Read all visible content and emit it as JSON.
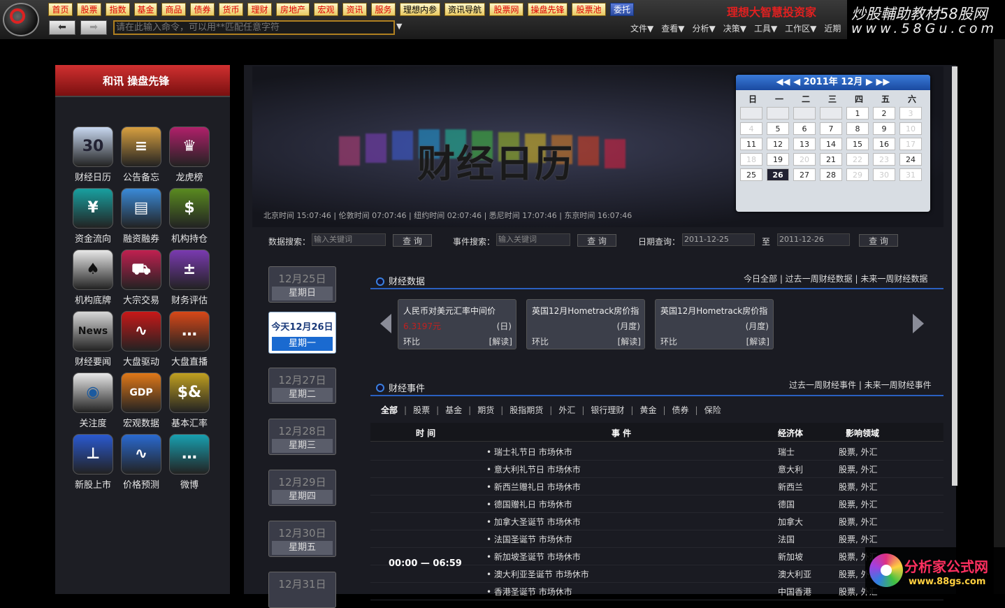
{
  "toolbar": {
    "nav": [
      "首页",
      "股票",
      "指数",
      "基金",
      "商品",
      "债券",
      "货币",
      "理财",
      "房地产",
      "宏观",
      "资讯",
      "服务",
      "理想内参",
      "资讯导航",
      "股票网",
      "操盘先锋",
      "股票池",
      "委托"
    ],
    "brand": "理想大智慧投资家",
    "command_placeholder": "请在此输入命令，可以用**匹配任意字符",
    "menu": [
      "文件▼",
      "查看▼",
      "分析▼",
      "决策▼",
      "工具▼",
      "工作区▼",
      "近期"
    ]
  },
  "watermark_top": {
    "line1": "炒股輔助教材58股网",
    "line2": "www.58Gu.com"
  },
  "watermark_bottom": {
    "line1": "分析家公式网",
    "line2": "www.88gs.com"
  },
  "left_panel": {
    "title": "和讯 操盘先锋",
    "tiles": [
      {
        "label": "财经日历",
        "glyph": "30",
        "color": "#c8d8f0",
        "text_color": "#223"
      },
      {
        "label": "公告备忘",
        "glyph": "≡",
        "color": "#d8a040",
        "text_color": "#fff"
      },
      {
        "label": "龙虎榜",
        "glyph": "♛",
        "color": "#b0206a",
        "text_color": "#fff"
      },
      {
        "label": "资金流向",
        "glyph": "¥",
        "color": "#18a0a0",
        "text_color": "#fff"
      },
      {
        "label": "融资融券",
        "glyph": "▤",
        "color": "#3a8ad8",
        "text_color": "#fff"
      },
      {
        "label": "机构持仓",
        "glyph": "$",
        "color": "#5a8a20",
        "text_color": "#fff"
      },
      {
        "label": "机构底牌",
        "glyph": "♠",
        "color": "#e8e8e8",
        "text_color": "#111"
      },
      {
        "label": "大宗交易",
        "glyph": "⛟",
        "color": "#c02050",
        "text_color": "#fff"
      },
      {
        "label": "财务评估",
        "glyph": "±",
        "color": "#7a3ab0",
        "text_color": "#fff"
      },
      {
        "label": "财经要闻",
        "glyph": "News",
        "color": "#d8d8d8",
        "text_color": "#111"
      },
      {
        "label": "大盘驱动",
        "glyph": "∿",
        "color": "#c81818",
        "text_color": "#fff"
      },
      {
        "label": "大盘直播",
        "glyph": "…",
        "color": "#d84818",
        "text_color": "#fff"
      },
      {
        "label": "关注度",
        "glyph": "◉",
        "color": "#e8e8e8",
        "text_color": "#1a5aa0"
      },
      {
        "label": "宏观数据",
        "glyph": "GDP",
        "color": "#e07818",
        "text_color": "#fff"
      },
      {
        "label": "基本汇率",
        "glyph": "$&",
        "color": "#c0a020",
        "text_color": "#fff"
      },
      {
        "label": "新股上市",
        "glyph": "⊥",
        "color": "#2a5ad0",
        "text_color": "#fff"
      },
      {
        "label": "价格预测",
        "glyph": "∿",
        "color": "#2a6ad0",
        "text_color": "#fff"
      },
      {
        "label": "微博",
        "glyph": "…",
        "color": "#18a0b0",
        "text_color": "#fff"
      }
    ]
  },
  "banner": {
    "title": "财经日历",
    "clocks": "北京时间 15:07:46 | 伦敦时间 07:07:46 | 纽约时间 02:07:46 | 悉尼时间 17:07:46 | 东京时间 16:07:46"
  },
  "calendar": {
    "header": "◀◀ ◀  2011年 12月  ▶ ▶▶",
    "weekdays": [
      "日",
      "一",
      "二",
      "三",
      "四",
      "五",
      "六"
    ],
    "days": [
      [
        "",
        "",
        "",
        "",
        "1",
        "2",
        "3"
      ],
      [
        "4",
        "5",
        "6",
        "7",
        "8",
        "9",
        "10"
      ],
      [
        "11",
        "12",
        "13",
        "14",
        "15",
        "16",
        "17"
      ],
      [
        "18",
        "19",
        "20",
        "21",
        "22",
        "23",
        "24"
      ],
      [
        "25",
        "26",
        "27",
        "28",
        "29",
        "30",
        "31"
      ]
    ],
    "selected": "26",
    "dim": [
      "3",
      "4",
      "10",
      "17",
      "18",
      "20",
      "22",
      "23",
      "29",
      "30",
      "31"
    ]
  },
  "search": {
    "data_label": "数据搜索：",
    "data_placeholder": "输入关键词",
    "event_label": "事件搜索：",
    "event_placeholder": "输入关键词",
    "date_label": "日期查询：",
    "date_from": "2011-12-25",
    "to": "至",
    "date_to": "2011-12-26",
    "btn": "查 询"
  },
  "dates": [
    {
      "d": "12月25日",
      "w": "星期日",
      "today": false
    },
    {
      "d": "今天12月26日",
      "w": "星期一",
      "today": true
    },
    {
      "d": "12月27日",
      "w": "星期二",
      "today": false
    },
    {
      "d": "12月28日",
      "w": "星期三",
      "today": false
    },
    {
      "d": "12月29日",
      "w": "星期四",
      "today": false
    },
    {
      "d": "12月30日",
      "w": "星期五",
      "today": false
    },
    {
      "d": "12月31日",
      "w": "",
      "today": false
    }
  ],
  "fin_data": {
    "title": "财经数据",
    "links": "今日全部 | 过去一周财经数据 | 未来一周财经数据",
    "cards": [
      {
        "name": "人民币对美元汇率中间价",
        "unit": "(日)",
        "value": "6.3197元",
        "value_green": false,
        "hb_label": "环比",
        "hb": "",
        "hb_green": true,
        "jd": "[解读]"
      },
      {
        "name": "英国12月Hometrack房价指",
        "unit": "(月度)",
        "value": "",
        "value_green": true,
        "hb_label": "环比",
        "hb": "",
        "hb_green": false,
        "jd": "[解读]"
      },
      {
        "name": "英国12月Hometrack房价指",
        "unit": "(月度)",
        "value": "",
        "value_green": true,
        "hb_label": "环比",
        "hb": "",
        "hb_green": false,
        "jd": "[解读]"
      }
    ]
  },
  "fin_events": {
    "title": "财经事件",
    "links": "过去一周财经事件 | 未来一周财经事件",
    "tabs": [
      "全部",
      "股票",
      "基金",
      "期货",
      "股指期货",
      "外汇",
      "银行理财",
      "黄金",
      "债券",
      "保险"
    ],
    "headers": [
      "时 间",
      "事 件",
      "经济体",
      "影响领域"
    ],
    "time": "00:00 — 06:59",
    "rows": [
      {
        "event": "• 瑞士礼节日 市场休市",
        "economy": "瑞士",
        "impact": "股票, 外汇"
      },
      {
        "event": "• 意大利礼节日 市场休市",
        "economy": "意大利",
        "impact": "股票, 外汇"
      },
      {
        "event": "• 新西兰赠礼日 市场休市",
        "economy": "新西兰",
        "impact": "股票, 外汇"
      },
      {
        "event": "• 德国赠礼日 市场休市",
        "economy": "德国",
        "impact": "股票, 外汇"
      },
      {
        "event": "• 加拿大圣诞节 市场休市",
        "economy": "加拿大",
        "impact": "股票, 外汇"
      },
      {
        "event": "• 法国圣诞节 市场休市",
        "economy": "法国",
        "impact": "股票, 外汇"
      },
      {
        "event": "• 新加坡圣诞节 市场休市",
        "economy": "新加坡",
        "impact": "股票, 外汇"
      },
      {
        "event": "• 澳大利亚圣诞节 市场休市",
        "economy": "澳大利亚",
        "impact": "股票, 外汇"
      },
      {
        "event": "• 香港圣诞节 市场休市",
        "economy": "中国香港",
        "impact": "股票, 外汇"
      }
    ]
  }
}
